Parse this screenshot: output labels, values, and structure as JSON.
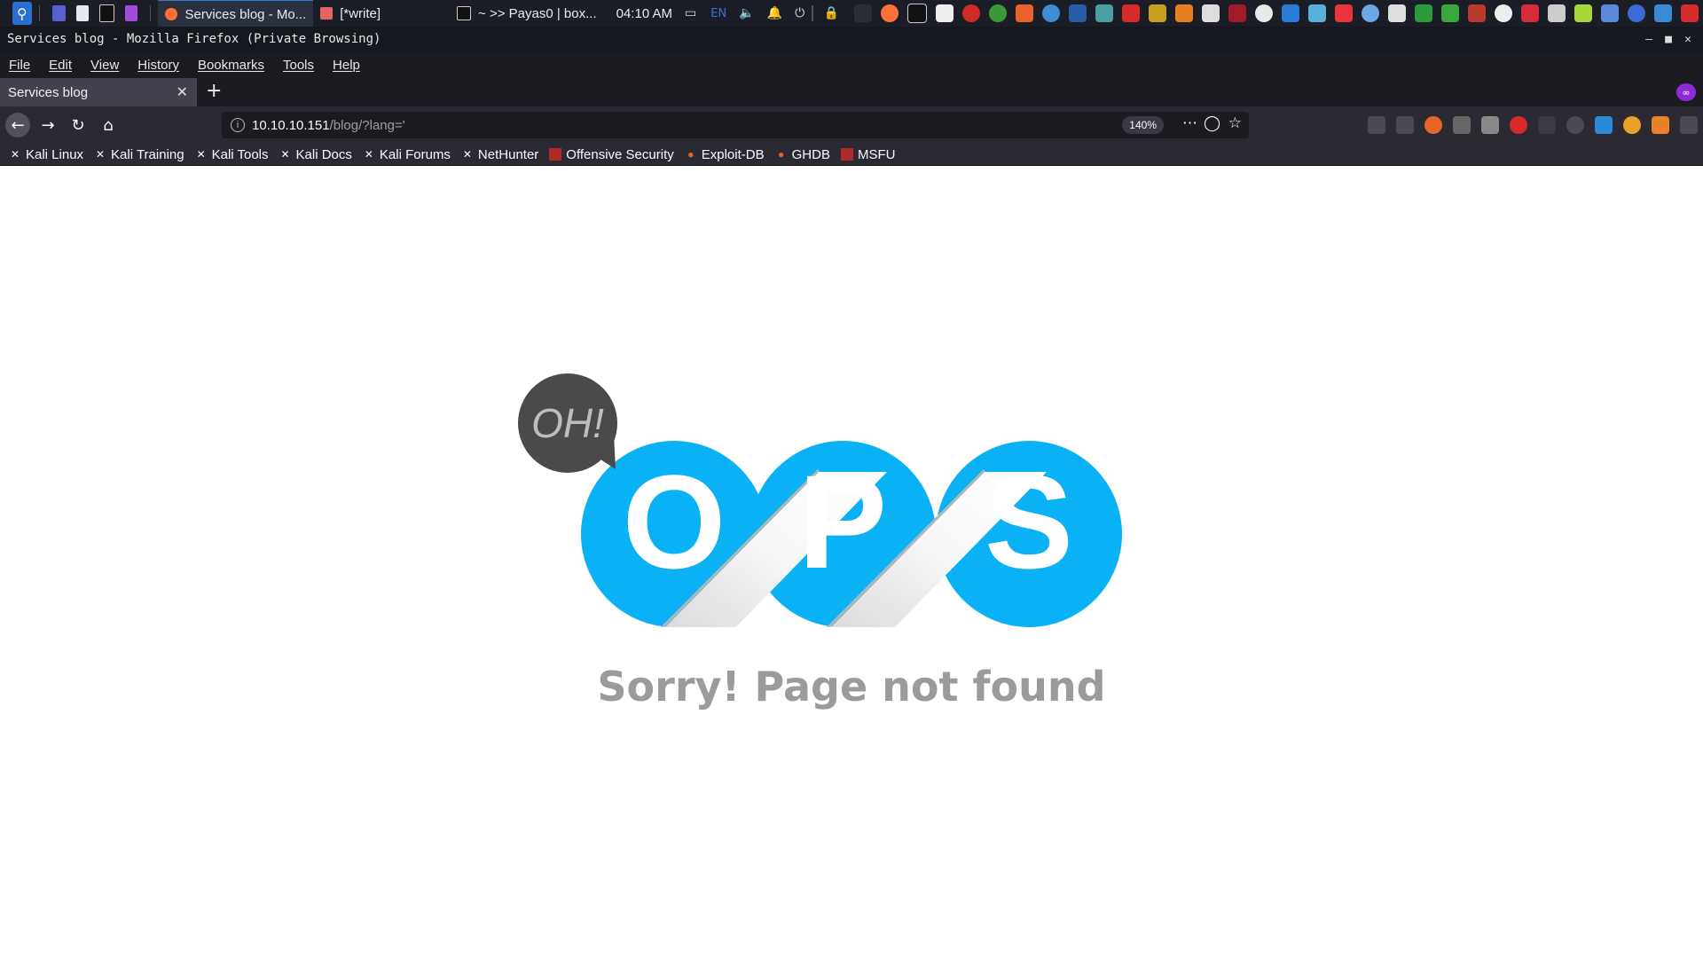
{
  "panel": {
    "tasks": [
      {
        "label": "Services blog - Mo..."
      },
      {
        "label": "[*write]"
      },
      {
        "label": "~ >> Payas0 | box..."
      }
    ],
    "clock": "04:10 AM",
    "lang": "EN"
  },
  "window": {
    "title": "Services blog - Mozilla Firefox (Private Browsing)"
  },
  "menu": [
    "File",
    "Edit",
    "View",
    "History",
    "Bookmarks",
    "Tools",
    "Help"
  ],
  "tab": {
    "label": "Services blog",
    "new_tab": "+"
  },
  "url": {
    "host": "10.10.10.151",
    "path": "/blog/?lang='",
    "zoom": "140%"
  },
  "bookmarks": [
    "Kali Linux",
    "Kali Training",
    "Kali Tools",
    "Kali Docs",
    "Kali Forums",
    "NetHunter",
    "Offensive Security",
    "Exploit-DB",
    "GHDB",
    "MSFU"
  ],
  "page": {
    "bubble_text": "OH!",
    "letters": [
      "O",
      "P",
      "S"
    ],
    "message": "Sorry! Page not found"
  },
  "colors": {
    "accent_blue": "#0ab1f5",
    "bubble_gray": "#4a4a4a",
    "message_gray": "#9b9b9b"
  }
}
